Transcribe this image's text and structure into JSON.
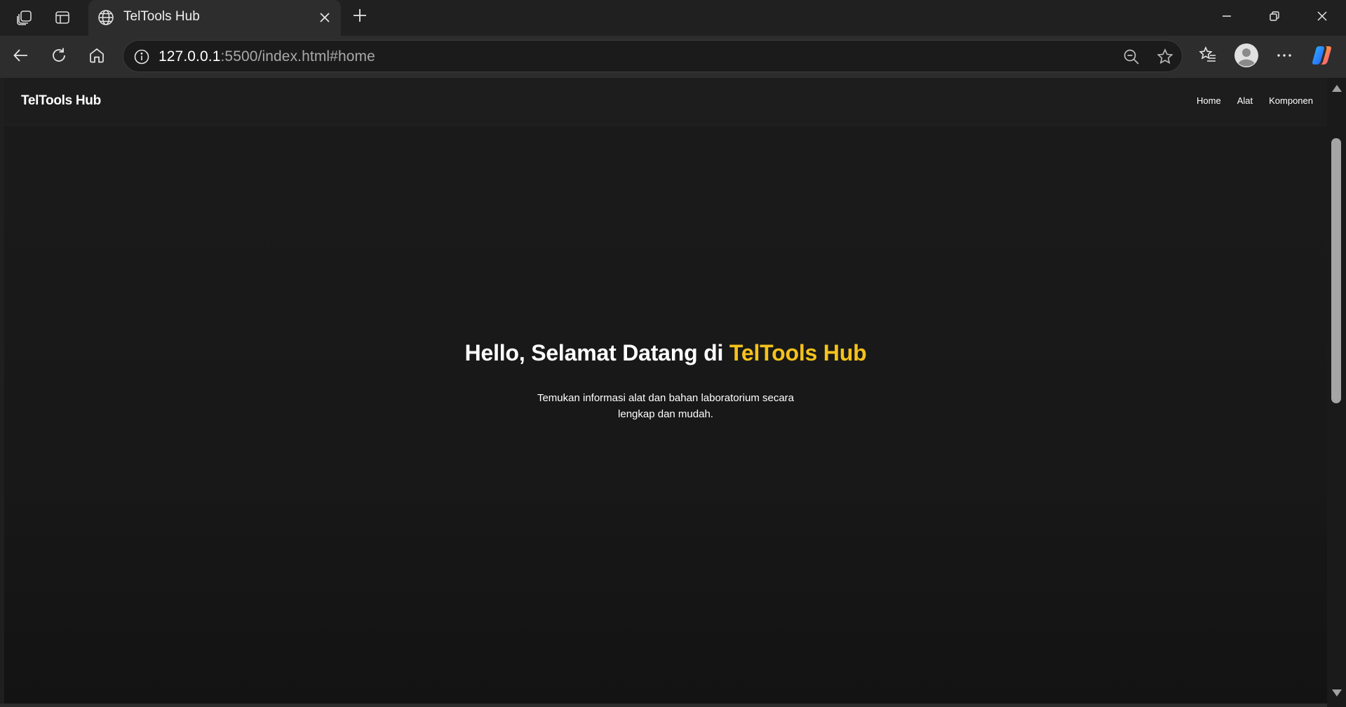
{
  "browser": {
    "tab_title": "TelTools Hub",
    "url_host": "127.0.0.1",
    "url_rest": ":5500/index.html#home",
    "icons": {
      "workspaces": "workspaces-icon",
      "tab_actions": "tab-actions-icon",
      "favicon": "globe-icon",
      "tab_close": "close-icon",
      "new_tab": "plus-icon",
      "minimize": "minimize-icon",
      "restore": "restore-icon",
      "window_close": "close-icon",
      "back": "back-arrow-icon",
      "refresh": "refresh-icon",
      "home": "home-icon",
      "site_info": "info-icon",
      "zoom_out": "zoom-out-icon",
      "favorite": "star-icon",
      "favorites": "favorites-icon",
      "profile": "avatar-icon",
      "more": "more-icon",
      "copilot": "copilot-icon"
    }
  },
  "site": {
    "brand": "TelTools Hub",
    "nav": [
      {
        "label": "Home"
      },
      {
        "label": "Alat"
      },
      {
        "label": "Komponen"
      }
    ],
    "hero": {
      "title_main": "Hello, Selamat Datang di ",
      "title_accent": "TelTools Hub",
      "subtitle": "Temukan informasi alat dan bahan laboratorium secara lengkap dan mudah."
    }
  },
  "colors": {
    "accent": "#f5c21b",
    "page_bg": "#181818",
    "nav_bg": "#1d1d1d"
  }
}
